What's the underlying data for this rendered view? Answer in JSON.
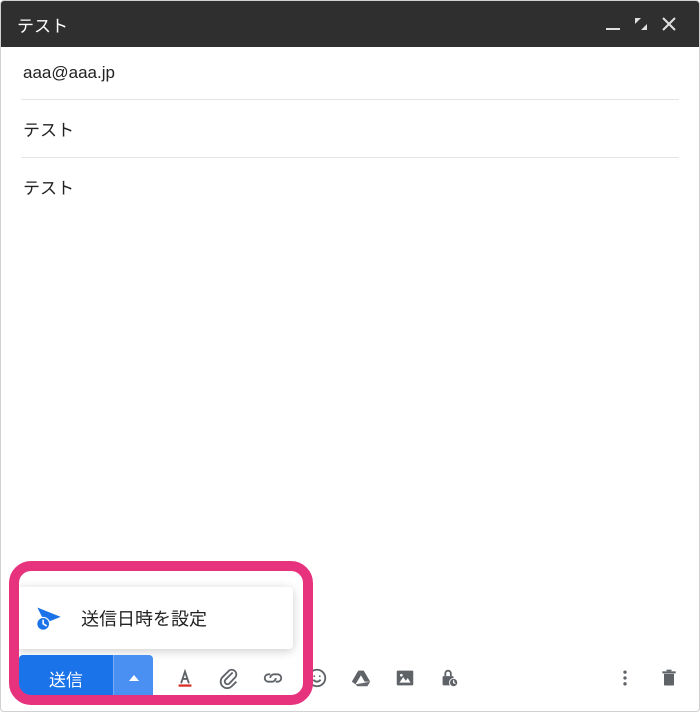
{
  "header": {
    "title": "テスト"
  },
  "fields": {
    "to": "aaa@aaa.jp",
    "subject": "テスト"
  },
  "body": {
    "content": "テスト"
  },
  "popup": {
    "schedule_label": "送信日時を設定"
  },
  "toolbar": {
    "send_label": "送信"
  },
  "colors": {
    "accent": "#1a73e8",
    "highlight": "#e7337d"
  }
}
